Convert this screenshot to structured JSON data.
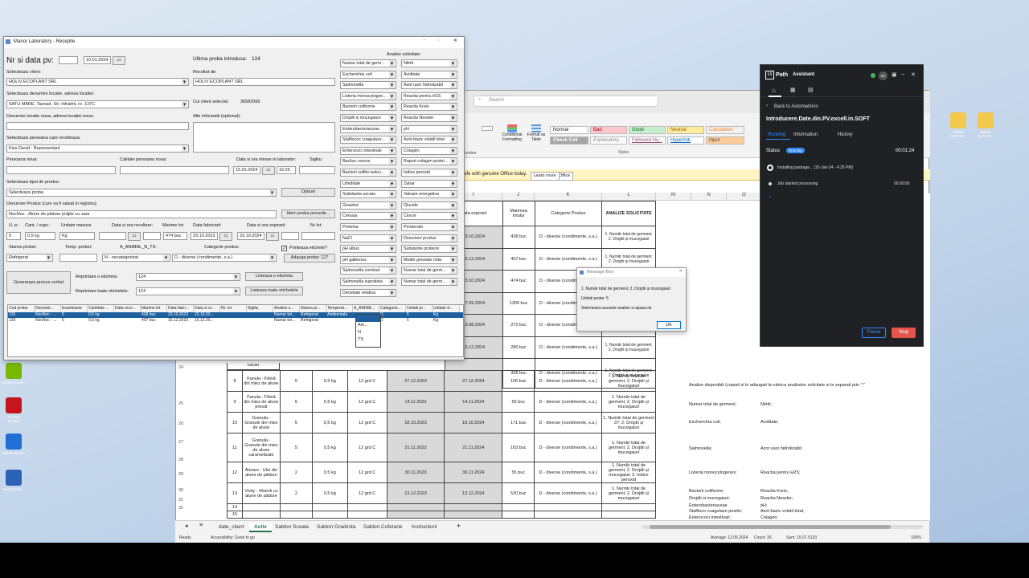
{
  "excel": {
    "search": "Search",
    "styles": [
      "Normal",
      "Bad",
      "Good",
      "Neutral",
      "Calculation",
      "Check Cell",
      "Explanatory...",
      "Followed Hy...",
      "Hyperlink",
      "Input"
    ],
    "ribbon_labels": {
      "cond": "Conditional Formatting",
      "fmt": "Format as Table",
      "group": "Styles",
      "number": "Number"
    },
    "warning": "safe with genuine Office today.",
    "warn_btn1": "Get genuine Office",
    "warn_btn2": "Learn more",
    "col_headers": [
      "I",
      "J",
      "K",
      "L",
      "M",
      "N",
      "O"
    ],
    "table_headers": {
      "exp": "Data expirarii",
      "marime": "Marimea lotului",
      "cat": "Categorie Produs",
      "analize": "ANALIZE SOLICITATE"
    },
    "upper_rows": [
      {
        "exp": "23.10.2024",
        "lot": "438 buc"
      },
      {
        "exp": "15.12.2024",
        "lot": "407 buc"
      },
      {
        "exp": "23.10.2024",
        "lot": "474 buc"
      },
      {
        "exp": "27.09.2024",
        "lot": "1306 buc"
      },
      {
        "exp": "19.08.2024",
        "lot": "272 buc"
      },
      {
        "exp": "15.12.2024",
        "lot": "280 buc"
      },
      {
        "exp": "15.12.2024",
        "lot": "338 buc"
      }
    ],
    "upper_cat": "D - diverse (condimente, s.a.)",
    "upper_analize": "1. Număr total de germeni; 2. Drojdii și mucegaiuri",
    "cacao": "cacao",
    "lower_rows": [
      {
        "nr": "8",
        "prod": "Fanula - Făină din miez de alune",
        "n": "5",
        "cant": "0,5 kg",
        "temp": "12 grd C",
        "d1": "27.12.2023",
        "d2": "27.12.2024",
        "lot": "106 buc",
        "cat": "D - diverse (condimente, s.a.)",
        "an": "1. Număr total de germeni; 2. Drojdii și mucegaiuri"
      },
      {
        "nr": "9",
        "prod": "Fanula - Făină din miez de alune presat",
        "n": "5",
        "cant": "0,5 kg",
        "temp": "12 grd C",
        "d1": "14.11.2023",
        "d2": "14.11.2024",
        "lot": "59 buc",
        "cat": "D - diverse (condimente, s.a.)",
        "an": "1. Număr total de germeni; 2. Drojdii și mucegaiuri"
      },
      {
        "nr": "10",
        "prod": "Granula - Granule din miez de alune",
        "n": "5",
        "cant": "0,5 kg",
        "temp": "12 grd C",
        "d1": "18.10.2023",
        "d2": "18.10.2024",
        "lot": "171 buc",
        "cat": "D - diverse (condimente, s.a.)",
        "an": "1. Număr total de germeni 37; 2. Drojdii și mucegaiuri"
      },
      {
        "nr": "11",
        "prod": "Granula - Granule din miez de alune caramelizate",
        "n": "5",
        "cant": "0,5 kg",
        "temp": "12 grd C",
        "d1": "21.11.2023",
        "d2": "21.11.2024",
        "lot": "163 buc",
        "cat": "D - diverse (condimente, s.a.)",
        "an": "1. Număr total de germeni; 2. Drojdii și mucegaiuri"
      },
      {
        "nr": "12",
        "prod": "Aluneo - Ulei din alune de pădure",
        "n": "2",
        "cant": "0,5 kg",
        "temp": "12 grd C",
        "d1": "30.11.2023",
        "d2": "30.11.2024",
        "lot": "55 buc",
        "cat": "D - diverse (condimente, s.a.)",
        "an": "1. Număr total de germeni; 2. Drojdii și mucegaiuri 3. Indice peroxid"
      },
      {
        "nr": "13",
        "prod": "Vivity - Muesli cu alune de pădure",
        "n": "2",
        "cant": "0,5 kg",
        "temp": "12 grd C",
        "d1": "13.12.2023",
        "d2": "13.12.2024",
        "lot": "530 buc",
        "cat": "D - diverse (condimente, s.a.)",
        "an": "1. Număr total de germeni; 2. Drojdii și mucegaiuri"
      },
      {
        "nr": "14"
      },
      {
        "nr": "15"
      }
    ],
    "row_numbers": [
      "24",
      "25",
      "26",
      "27",
      "28",
      "29",
      "30",
      "31",
      "32"
    ],
    "side_note": "Analize disponibili (copiati si le adaugati la rubrica analizelor solicitate si le separati prin \";\"",
    "side_pairs": [
      [
        "Numar total de germeni;",
        "Nitriti;"
      ],
      [
        "Escherichia coli;",
        "Aciditate;"
      ],
      [
        "Salmonella;",
        "Azot usor hidrolizabil;"
      ],
      [
        "Listeria monocytogenes;",
        "Reactia pentru H2S;"
      ],
      [
        "Bacterii coliforme;",
        "Reactia Kreis;"
      ],
      [
        "Drojdii si mucegaiuri;",
        "Reactia Nessler;"
      ],
      [
        "Enterobacteriaceae",
        "pH;"
      ],
      [
        "Stafiloco coagulazo pozitiv;",
        "Azot bazic volatil total;"
      ],
      [
        "Enterococi intestinali;",
        "Colagen;"
      ]
    ],
    "tabs": [
      "date_client",
      "Activ",
      "Sablon Scoala",
      "Sablon Gradinita",
      "Sablon Cofetarie",
      "Instructiuni"
    ],
    "active_tab": "Activ",
    "status": {
      "ready": "Ready",
      "access": "Accessibility: Good to go",
      "avg": "Average: 12.05.2024",
      "count": "Count: 26",
      "sum": "Sum: 15.07.5133",
      "zoom": "100%"
    }
  },
  "desktop_icons": [
    {
      "label": "FIRME SUPLIM..."
    },
    {
      "label": "FIRME SUPLIM..."
    },
    {
      "label": "NVIDIA Scrie..."
    },
    {
      "label": "Acrobat Reader"
    },
    {
      "label": "UiPath Studio"
    },
    {
      "label": "ExcelAnaly..."
    }
  ],
  "app": {
    "title": "Manor Laboratory - Receptie",
    "nr_data": "Nr si data pv:",
    "nr_value": "",
    "date_value": "10.01.2024",
    "ultima": "Ultima proba introdusa:",
    "ultima_val": "124",
    "sel_client": "Selecteaza client:",
    "client": "HOLIV ECOPLANT SRL",
    "recoltat": "Recoltat de:",
    "recoltat_val": "HOLIV ECOPLANT SRL",
    "sel_loc": "Selecteaza denumire locatie, adresa locatiei:",
    "loc": "SATU MARE, Tasnad, Str. Infratirii, nr. 137C",
    "cui": "Cui client selectat:",
    "cui_val": "36582066",
    "den_loc": "Denumire locatie noua, adresa locatiei noua:",
    "alte": "Alte informatii (optional):",
    "sel_pers": "Selecteaza persoana care recolteaza:",
    "pers": "Kiss David : Reprezentant",
    "pers_noua": "Persoana noua:",
    "calit": "Calitate persoana noua:",
    "data_intrare": "Data si ora intrare in laborator:",
    "intr_date": "15.01.2024",
    "intr_time": "16:25",
    "sigiliu": "Sigiliu:",
    "sel_tip": "Selecteaza tipul de produs:",
    "tip": "Selecteaza proba",
    "optiuni": "Optiuni",
    "den_prod": "Denumire Produs (cum va fi salvat in registru):",
    "prod": "NocNoc - Alune de pădure prăjite cu sare",
    "idem": "Idem proba precede...",
    "hdr_u": "U. p.:",
    "hdr_cant": "Cant. / supr.:",
    "hdr_um": "Unitate masura",
    "hdr_recolt": "Data si ora recoltare:",
    "hdr_marime": "Marime lot:",
    "hdr_fabr": "Data fabricarii:",
    "hdr_exp": "Data si ora expirarii:",
    "hdr_nrlot": "Nr lot:",
    "u": "5",
    "cant": "0.5 kg",
    "um": "Kg",
    "marime": "474 buc",
    "fabr": "23.10.2023",
    "exp": "23.10.2024",
    "hdr_stare": "Starea probei:",
    "hdr_temp": "Temp. probei:",
    "hdr_anim": "A_ANIMAL_N_TS:",
    "hdr_cat": "Categorie produs:",
    "stare": "Refrigerat",
    "anim": "N - necategorizat",
    "cat": "D - diverse (condimente, s.a.)",
    "print_chk": "Printeaza etichete?",
    "adauga": "Adauga proba: 127",
    "genereaza": "Genereaza proces verbal",
    "repr_una": "Reprintare o eticheta:",
    "repr_una_val": "124",
    "listeaza_una": "Listeaza o eticheta",
    "repr_toate": "Reprintare toate etichetele:",
    "repr_toate_val": "124",
    "listeaza_toate": "Listeaza toate etichetele",
    "analize_title": "Analize solicitate:",
    "analize_left": [
      "Numar total de germ...",
      "Escherichia coli",
      "Salmonella",
      "Listeria monocytogen...",
      "Bacterii coliforme",
      "Drojdii si mucegaiuri",
      "Enterobacteriaceae",
      "Stafilococ coagulazo...",
      "Enterococi intestinali",
      "Bacilus cereus",
      "Bacterii sulfito-reduc...",
      "Umiditate",
      "Substanta uscata",
      "Grasime",
      "Cenusa",
      "Proteina",
      "NaCl",
      "pH albus",
      "pH galbenus",
      "Salmonella continut",
      "Salmonella suprafata",
      "Densitate relativa"
    ],
    "analize_right": [
      "Nitriti",
      "Aciditate",
      "Azot usor hidrolizabil",
      "Reactia pentru H2S",
      "Reactia Kreis",
      "Reactia Nessler",
      "pH",
      "Azot bazic volatil total",
      "Colagen",
      "Raport colagen protei...",
      "Indice peroxid",
      "Zahar",
      "Valoare energetica",
      "Glucide",
      "Cloruri",
      "Ponderale",
      "Descriere produs",
      "Substante proteice",
      "Medie greutate neta",
      "Numar total de germ...",
      "Numar total de germ..."
    ],
    "res_headers": [
      "Cod proba",
      "Denumir...",
      "Esantioane",
      "Cantitate ...",
      "Data reco...",
      "Marime lot",
      "Data fabri...",
      "Data si or...",
      "Nr. lot",
      "Sigiliu",
      "Analize s...",
      "Starea pr...",
      "Temperat...",
      "A_ANIMA...",
      "Categorie...",
      "Unitati pr...",
      "Unitate d..."
    ],
    "res_rows": [
      [
        "125",
        "NocNoc - ...",
        "5",
        "0,5 kg",
        "",
        "438 buc",
        "23.10.2023",
        "23.10.20...",
        "",
        "",
        "Numar tot...",
        "Refrigerat",
        "Ambientala",
        "",
        "D",
        "5",
        "Kg"
      ],
      [
        "126",
        "NocNoc - ...",
        "5",
        "0,5 kg",
        "",
        "407 buc",
        "15.12.2023",
        "15.12.20...",
        "",
        "",
        "Numar tot...",
        "Refrigerat",
        "",
        "",
        "D",
        "5",
        "Kg"
      ]
    ],
    "popup_opts": [
      "",
      "Am...",
      "N",
      "TS"
    ]
  },
  "msgbox": {
    "title": "Message Box",
    "line1": "1. Număr total de germeni; 2. Drojdii și mucegaiuri",
    "line2": "Unitati probe: 5",
    "line3": "Selecteaza aceaste analize si apasa ok",
    "ok": "OK"
  },
  "uipath": {
    "brand": "Path",
    "brand_prefix": "Ui",
    "assistant": "Assistant",
    "avatar": "VC",
    "back": "Back to Automations",
    "name": "Introducere.Date.din.PV.excell.in.SOFT",
    "tabs": [
      "Running",
      "Information",
      "History"
    ],
    "status_label": "Status",
    "status_badge": "Running",
    "elapsed": "00:01:24",
    "steps": [
      {
        "text": "Installing package... [15-Jan-24 - 4:25 PM]",
        "time": ""
      },
      {
        "text": "Job started processing",
        "time": "00:00:00"
      }
    ],
    "pause": "Pause",
    "stop": "Stop",
    "accent": "#2f8cff",
    "stop_color": "#e5534b"
  }
}
